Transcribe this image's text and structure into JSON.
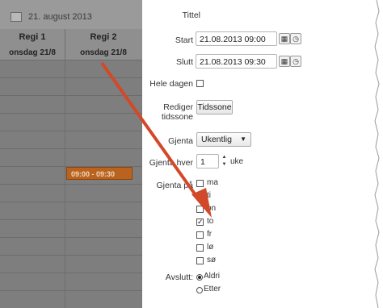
{
  "calendar": {
    "date": "21. august 2013",
    "columns": [
      {
        "title": "Regi 1",
        "subtitle": "onsdag 21/8"
      },
      {
        "title": "Regi 2",
        "subtitle": "onsdag 21/8"
      }
    ],
    "event_time": "09:00 - 09:30"
  },
  "form": {
    "title_label": "Tittel",
    "start_label": "Start",
    "start_value": "21.08.2013 09:00",
    "end_label": "Slutt",
    "end_value": "21.08.2013 09:30",
    "allday_label": "Hele dagen",
    "timezone_label_1": "Rediger",
    "timezone_label_2": "tidssone",
    "timezone_button": "Tidssone",
    "repeat_label": "Gjenta",
    "repeat_value": "Ukentlig",
    "every_label": "Gjenta hver",
    "every_value": "1",
    "every_unit": "uke",
    "repeat_on_label": "Gjenta på",
    "days": [
      {
        "label": "ma",
        "checked": false
      },
      {
        "label": "ti",
        "checked": false
      },
      {
        "label": "on",
        "checked": false
      },
      {
        "label": "to",
        "checked": true
      },
      {
        "label": "fr",
        "checked": false
      },
      {
        "label": "lø",
        "checked": false
      },
      {
        "label": "sø",
        "checked": false
      }
    ],
    "end_repeat_label": "Avslutt:",
    "end_options": [
      {
        "label": "Aldri",
        "selected": true
      },
      {
        "label": "Etter",
        "selected": false
      }
    ]
  },
  "colors": {
    "overlay": "#7e7e7e",
    "event": "#b9631e",
    "arrow": "#d2492a"
  },
  "icons": [
    "calendar-icon",
    "clock-icon",
    "stepper-icon",
    "dropdown-caret-icon",
    "check-icon"
  ]
}
